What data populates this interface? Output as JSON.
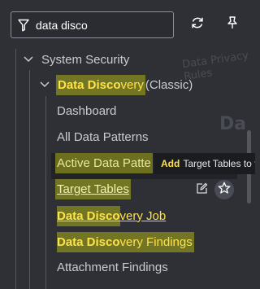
{
  "colors": {
    "background": "#2f3036",
    "highlight": "#cfd325",
    "highlight_text": "#ffe14a",
    "row_selected": "#222328"
  },
  "filter": {
    "value": "data disco",
    "icon": "filter-icon"
  },
  "toolbar": {
    "refresh_icon": "refresh-icon",
    "pin_icon": "pin-icon"
  },
  "background_text": {
    "ghost1": "Data Privacy Rules",
    "ghost2": "Da"
  },
  "tree": {
    "system_security": {
      "label": "System Security"
    },
    "data_discovery": {
      "label_match": "Data Disco",
      "label_rest": "very",
      "suffix": " (Classic)"
    },
    "items": {
      "dashboard": "Dashboard",
      "all_data_patterns": "All Data Patterns",
      "active_data_patterns": "Active Data Patte",
      "target_tables": "Target Tables",
      "data_discovery_job": {
        "match": "Data Disco",
        "rest": "very Job"
      },
      "data_discovery_findings": {
        "match": "Data Disco",
        "rest": "very Findings"
      },
      "attachment_findings": "Attachment Findings"
    }
  },
  "tooltip": {
    "highlight": "Add",
    "text": "Target Tables to fa"
  },
  "actions": {
    "edit_icon": "edit-icon",
    "favorite_icon": "star-icon"
  }
}
